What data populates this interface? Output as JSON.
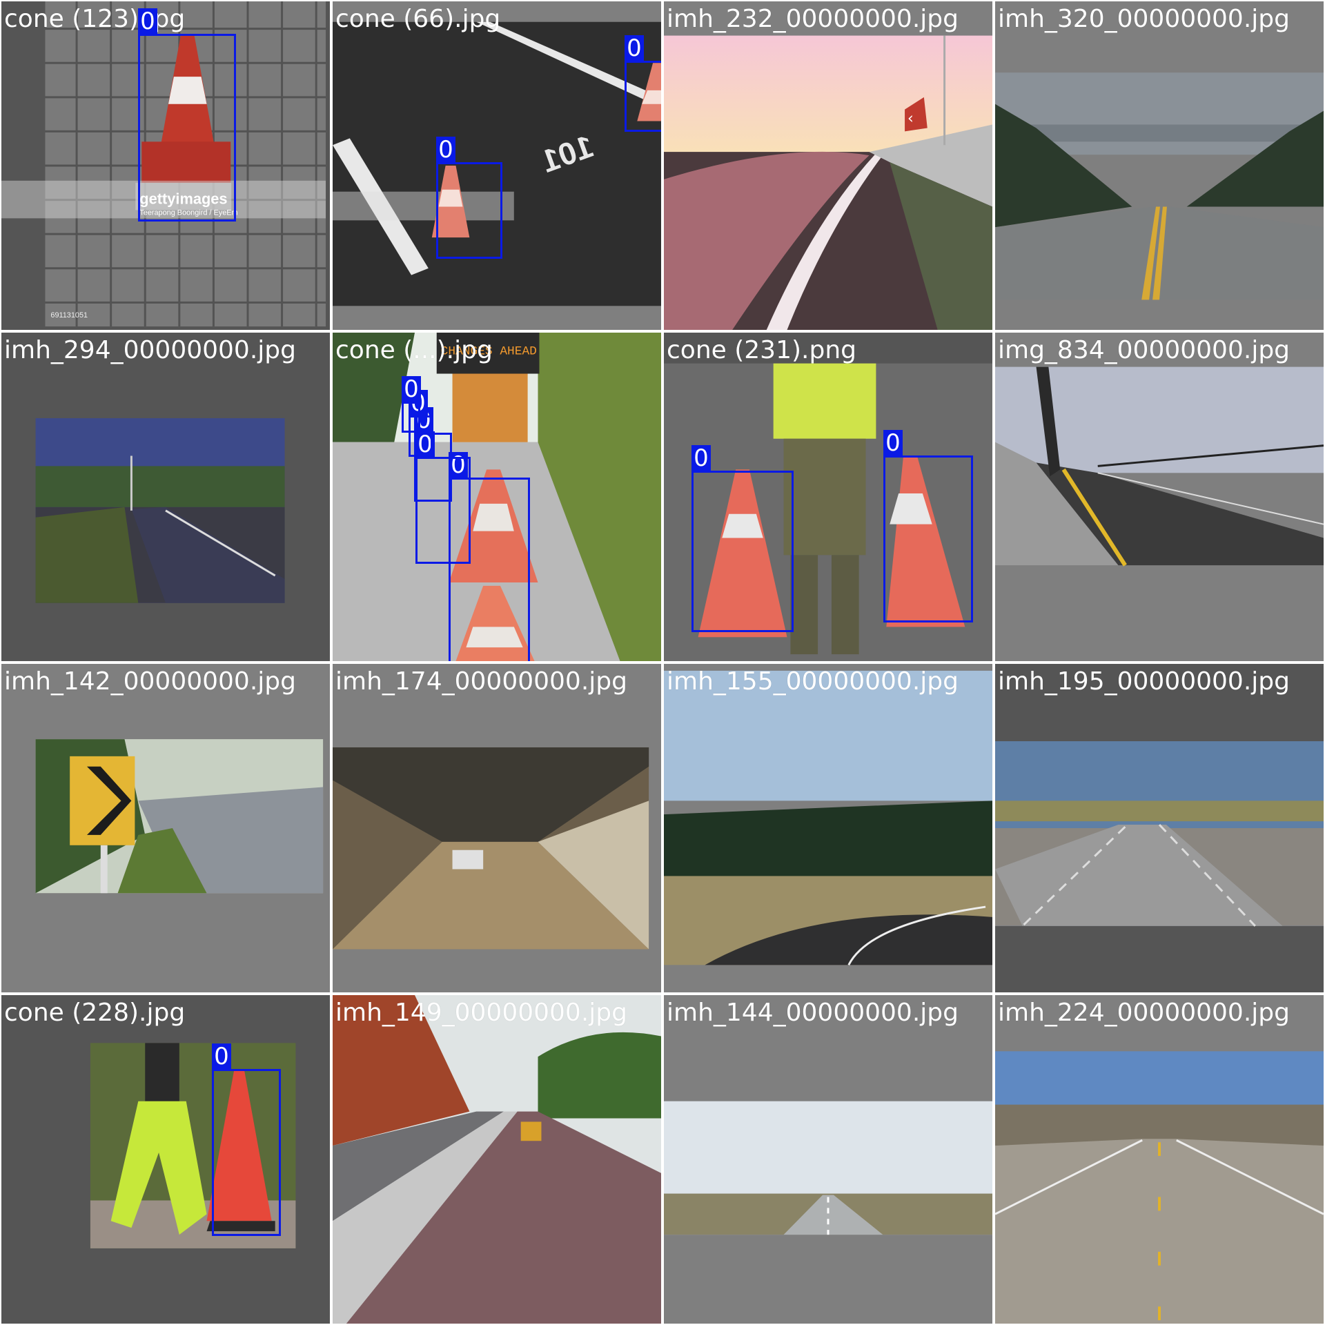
{
  "mosaic": {
    "tiles": [
      {
        "filename": "cone (123).jpg",
        "detections": [
          "0"
        ]
      },
      {
        "filename": "cone (66).jpg",
        "detections": [
          "0",
          "0"
        ]
      },
      {
        "filename": "imh_232_00000000.jpg",
        "detections": []
      },
      {
        "filename": "imh_320_00000000.jpg",
        "detections": []
      },
      {
        "filename": "imh_294_00000000.jpg",
        "detections": []
      },
      {
        "filename": "cone (...).jpg",
        "detections": [
          "0",
          "0",
          "0",
          "0",
          "0"
        ]
      },
      {
        "filename": "cone (231).png",
        "detections": [
          "0",
          "0"
        ]
      },
      {
        "filename": "img_834_00000000.jpg",
        "detections": []
      },
      {
        "filename": "imh_142_00000000.jpg",
        "detections": []
      },
      {
        "filename": "imh_174_00000000.jpg",
        "detections": []
      },
      {
        "filename": "imh_155_00000000.jpg",
        "detections": []
      },
      {
        "filename": "imh_195_00000000.jpg",
        "detections": []
      },
      {
        "filename": "cone (228).jpg",
        "detections": [
          "0"
        ]
      },
      {
        "filename": "imh_149_00000000.jpg",
        "detections": []
      },
      {
        "filename": "imh_144_00000000.jpg",
        "detections": []
      },
      {
        "filename": "imh_224_00000000.jpg",
        "detections": []
      }
    ],
    "watermark": {
      "brand": "gettyimages",
      "credit": "Teerapong Boongird / EyeEm",
      "id": "691131051"
    },
    "sign_text": "CHANGES AHEAD",
    "box_color": "#0a1ae6",
    "pad_colors": [
      "#555555",
      "#7f7f7f"
    ]
  }
}
